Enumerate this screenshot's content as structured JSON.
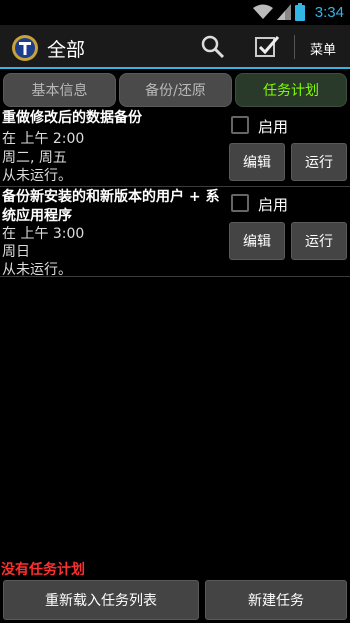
{
  "status_bar": {
    "time": "3:34"
  },
  "action_bar": {
    "title": "全部",
    "menu_label": "菜单"
  },
  "tabs": [
    {
      "label": "基本信息",
      "active": false
    },
    {
      "label": "备份/还原",
      "active": false
    },
    {
      "label": "任务计划",
      "active": true
    }
  ],
  "tasks": [
    {
      "title": "重做修改后的数据备份",
      "time": "在 上午 2:00",
      "days": "周二, 周五",
      "enable_label": "启用",
      "edit_label": "编辑",
      "run_label": "运行"
    },
    {
      "title": "备份新安装的和新版本的用户 + 系统应用程序",
      "time": "在 上午 3:00",
      "days": "周日",
      "last_run": "从未运行。",
      "enable_label": "启用",
      "edit_label": "编辑",
      "run_label": "运行"
    }
  ],
  "first_task_last_run": "从未运行。",
  "empty_message": "没有任务计划",
  "bottom": {
    "reload_label": "重新载入任务列表",
    "new_label": "新建任务"
  },
  "colors": {
    "accent": "#33b5e5",
    "active_tab_text": "#7fff00",
    "warning": "#ff3030"
  }
}
